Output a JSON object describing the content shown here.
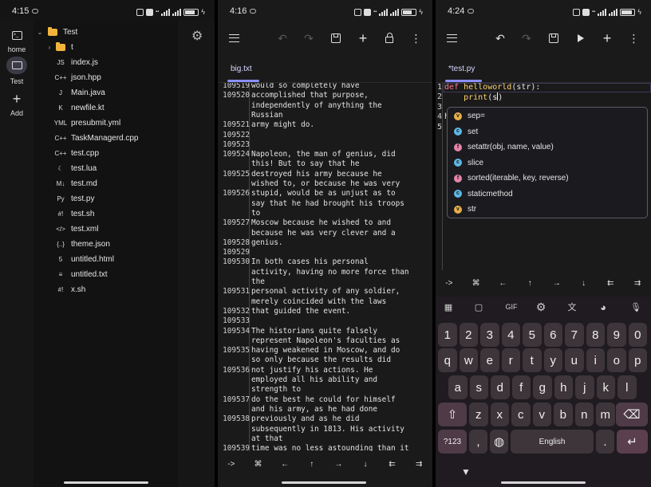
{
  "colors": {
    "folder": "#f2b33d",
    "tab_accent": "#8b90ff",
    "keyword": "#ff7a8a",
    "function": "#ffd36e",
    "battery_fill": "#dddddd"
  },
  "screens": [
    {
      "status": {
        "time": "4:15",
        "battery": "82"
      },
      "rail": [
        {
          "label": "home",
          "icon": "terminal-icon"
        },
        {
          "label": "Test",
          "icon": "folder-icon",
          "active": true
        },
        {
          "label": "Add",
          "icon": "plus-icon"
        }
      ],
      "tree": {
        "root": "Test",
        "items": [
          {
            "name": "t",
            "type": "folder"
          },
          {
            "name": "index.js",
            "icon": "JS"
          },
          {
            "name": "json.hpp",
            "icon": "C++"
          },
          {
            "name": "Main.java",
            "icon": "J"
          },
          {
            "name": "newfile.kt",
            "icon": "K"
          },
          {
            "name": "presubmit.yml",
            "icon": "YML"
          },
          {
            "name": "TaskManagerd.cpp",
            "icon": "C++"
          },
          {
            "name": "test.cpp",
            "icon": "C++"
          },
          {
            "name": "test.lua",
            "icon": "☾"
          },
          {
            "name": "test.md",
            "icon": "M↓"
          },
          {
            "name": "test.py",
            "icon": "Py"
          },
          {
            "name": "test.sh",
            "icon": "#!"
          },
          {
            "name": "test.xml",
            "icon": "</>"
          },
          {
            "name": "theme.json",
            "icon": "{..}"
          },
          {
            "name": "untitled.html",
            "icon": "5"
          },
          {
            "name": "untitled.txt",
            "icon": "≡"
          },
          {
            "name": "x.sh",
            "icon": "#!"
          }
        ]
      }
    },
    {
      "status": {
        "time": "4:16",
        "battery": "72"
      },
      "tab": "big.txt",
      "lines": [
        {
          "n": "109519",
          "t": "would so completely have"
        },
        {
          "n": "109520",
          "t": "accomplished that purpose,"
        },
        {
          "n": "",
          "t": "independently of anything the"
        },
        {
          "n": "",
          "t": "Russian"
        },
        {
          "n": "109521",
          "t": "army might do."
        },
        {
          "n": "109522",
          "t": ""
        },
        {
          "n": "109523",
          "t": ""
        },
        {
          "n": "109524",
          "t": "Napoleon, the man of genius, did"
        },
        {
          "n": "",
          "t": "this! But to say that he"
        },
        {
          "n": "109525",
          "t": "destroyed his army because he"
        },
        {
          "n": "",
          "t": "wished to, or because he was very"
        },
        {
          "n": "109526",
          "t": "stupid, would be as unjust as to"
        },
        {
          "n": "",
          "t": "say that he had brought his troops"
        },
        {
          "n": "",
          "t": "to"
        },
        {
          "n": "109527",
          "t": "Moscow because he wished to and"
        },
        {
          "n": "",
          "t": "because he was very clever and a"
        },
        {
          "n": "109528",
          "t": "genius."
        },
        {
          "n": "109529",
          "t": ""
        },
        {
          "n": "109530",
          "t": "In both cases his personal"
        },
        {
          "n": "",
          "t": "activity, having no more force than"
        },
        {
          "n": "",
          "t": "the"
        },
        {
          "n": "109531",
          "t": "personal activity of any soldier,"
        },
        {
          "n": "",
          "t": "merely coincided with the laws"
        },
        {
          "n": "109532",
          "t": "that guided the event."
        },
        {
          "n": "109533",
          "t": ""
        },
        {
          "n": "109534",
          "t": "The historians quite falsely"
        },
        {
          "n": "",
          "t": "represent Napoleon's faculties as"
        },
        {
          "n": "109535",
          "t": "having weakened in Moscow, and do"
        },
        {
          "n": "",
          "t": "so only because the results did"
        },
        {
          "n": "109536",
          "t": "not justify his actions. He"
        },
        {
          "n": "",
          "t": "employed all his ability and"
        },
        {
          "n": "",
          "t": "strength to"
        },
        {
          "n": "109537",
          "t": "do the best he could for himself"
        },
        {
          "n": "",
          "t": "and his army, as he had done"
        },
        {
          "n": "109538",
          "t": "previously and as he did"
        },
        {
          "n": "",
          "t": "subsequently in 1813. His activity"
        },
        {
          "n": "",
          "t": "at that"
        },
        {
          "n": "109539",
          "t": "time was no less astounding than it"
        }
      ],
      "keys": [
        "->",
        "⌘",
        "←",
        "↑",
        "→",
        "↓",
        "⇇",
        "⇉"
      ]
    },
    {
      "status": {
        "time": "4:24",
        "battery": "85"
      },
      "tab": "*test.py",
      "code": {
        "line1_kw": "def",
        "line1_fn": "helloworld",
        "line1_rest": "(str):",
        "line2_fn": "print",
        "line2_rest": "(s)",
        "line4_stub": "h",
        "gutter": [
          "1",
          "2",
          "3",
          "4",
          "5"
        ]
      },
      "autocomplete": [
        {
          "label": "sep=",
          "kind": "v",
          "color": "#e8b04a"
        },
        {
          "label": "set",
          "kind": "c",
          "color": "#5fb9e6"
        },
        {
          "label": "setattr(obj, name, value)",
          "kind": "f",
          "color": "#e784a8"
        },
        {
          "label": "slice",
          "kind": "c",
          "color": "#5fb9e6"
        },
        {
          "label": "sorted(iterable, key, reverse)",
          "kind": "f",
          "color": "#e784a8"
        },
        {
          "label": "staticmethod",
          "kind": "c",
          "color": "#5fb9e6"
        },
        {
          "label": "str",
          "kind": "v",
          "color": "#e8b04a"
        }
      ],
      "keys": [
        "->",
        "⌘",
        "←",
        "↑",
        "→",
        "↓",
        "⇇",
        "⇉"
      ],
      "keyboard": {
        "tools": [
          "GIF"
        ],
        "row_num": [
          "1",
          "2",
          "3",
          "4",
          "5",
          "6",
          "7",
          "8",
          "9",
          "0"
        ],
        "row1": [
          "q",
          "w",
          "e",
          "r",
          "t",
          "y",
          "u",
          "i",
          "o",
          "p"
        ],
        "row2": [
          "a",
          "s",
          "d",
          "f",
          "g",
          "h",
          "j",
          "k",
          "l"
        ],
        "row3": [
          "z",
          "x",
          "c",
          "v",
          "b",
          "n",
          "m"
        ],
        "sym": "?123",
        "comma": ",",
        "space": "English",
        "period": "."
      }
    }
  ]
}
